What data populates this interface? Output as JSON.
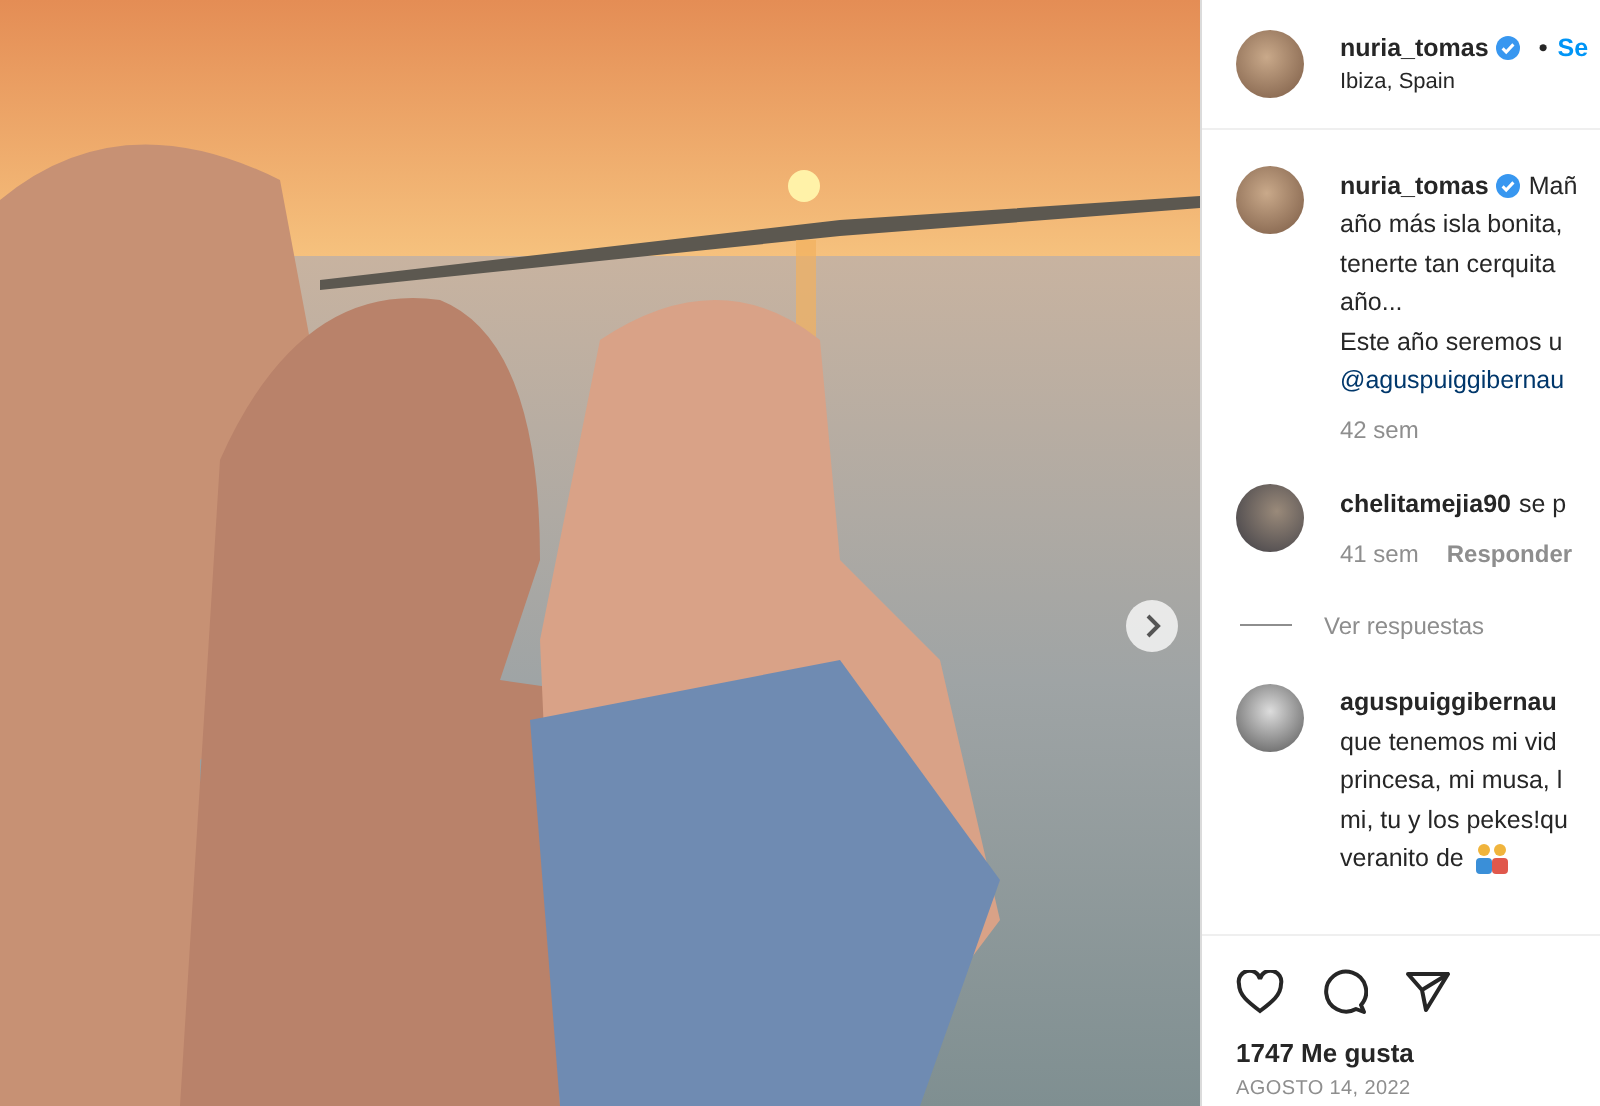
{
  "header": {
    "username": "nuria_tomas",
    "verified": true,
    "separator": "•",
    "follow": "Se",
    "location": "Ibiza, Spain"
  },
  "comments": [
    {
      "username": "nuria_tomas",
      "verified": true,
      "lines": [
        "Mañ",
        "año más isla bonita,",
        "tenerte tan cerquita",
        "año...",
        "Este año seremos u"
      ],
      "mention": "@aguspuiggibernau",
      "time": "42 sem",
      "has_emoji": false
    },
    {
      "username": "chelitamejia90",
      "verified": false,
      "lines": [
        "se p"
      ],
      "time": "41 sem",
      "reply": "Responder",
      "view_replies": "Ver respuestas",
      "has_emoji": false
    },
    {
      "username": "aguspuiggibernau",
      "verified": false,
      "lines": [
        "que tenemos mi vid",
        "princesa, mi musa, l",
        "mi, tu y los pekes!qu",
        "veranito de"
      ],
      "has_emoji": true
    }
  ],
  "likes": "1747 Me gusta",
  "date": "AGOSTO 14, 2022"
}
